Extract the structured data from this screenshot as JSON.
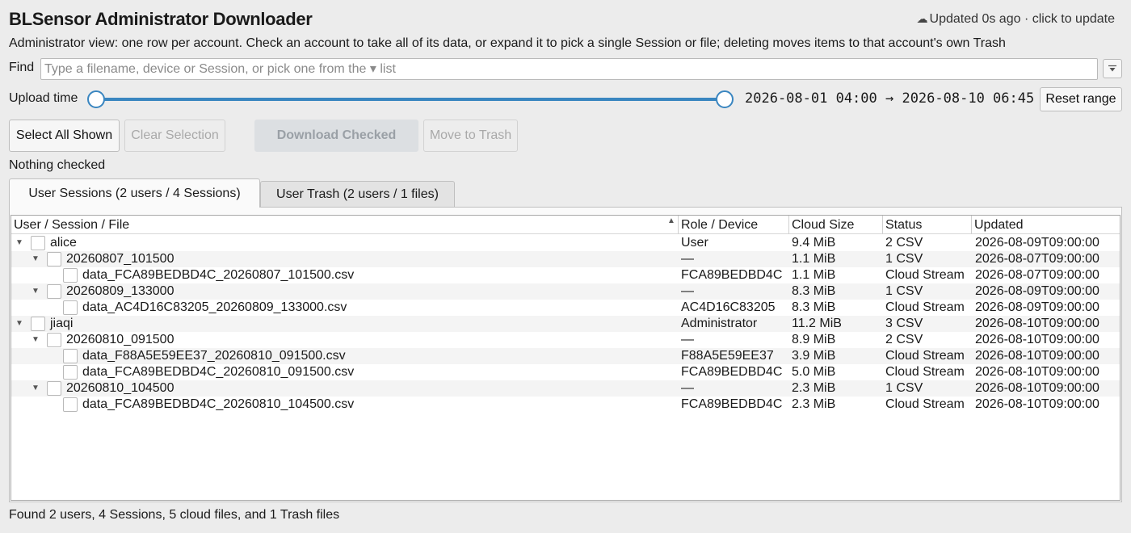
{
  "app": {
    "title": "BLSensor Administrator Downloader",
    "updated_text": "Updated 0s ago · click to update",
    "description": "Administrator view: one row per account. Check an account to take all of its data, or expand it to pick a single Session or file; deleting moves items to that account's own Trash"
  },
  "find": {
    "label": "Find",
    "placeholder": "Type a filename, device or Session, or pick one from the ▾ list",
    "value": ""
  },
  "upload": {
    "label": "Upload time",
    "range_text": "2026-08-01 04:00 → 2026-08-10 06:45",
    "reset_label": "Reset range"
  },
  "toolbar": {
    "select_all": "Select All Shown",
    "clear_selection": "Clear Selection",
    "download_checked": "Download Checked",
    "move_to_trash": "Move to Trash"
  },
  "selection_status": "Nothing checked",
  "tabs": [
    {
      "label": "User Sessions (2 users / 4 Sessions)",
      "active": true
    },
    {
      "label": "User Trash (2 users / 1 files)",
      "active": false
    }
  ],
  "columns": [
    "User / Session / File",
    "Role / Device",
    "Cloud Size",
    "Status",
    "Updated"
  ],
  "rows": [
    {
      "level": 0,
      "expanded": true,
      "name": "alice",
      "role": "User",
      "size": "9.4 MiB",
      "status": "2 CSV",
      "updated": "2026-08-09T09:00:00"
    },
    {
      "level": 1,
      "expanded": true,
      "name": "20260807_101500",
      "role": "—",
      "size": "1.1 MiB",
      "status": "1 CSV",
      "updated": "2026-08-07T09:00:00"
    },
    {
      "level": 2,
      "name": "data_FCA89BEDBD4C_20260807_101500.csv",
      "role": "FCA89BEDBD4C",
      "size": "1.1 MiB",
      "status": "Cloud Stream",
      "updated": "2026-08-07T09:00:00"
    },
    {
      "level": 1,
      "expanded": true,
      "name": "20260809_133000",
      "role": "—",
      "size": "8.3 MiB",
      "status": "1 CSV",
      "updated": "2026-08-09T09:00:00"
    },
    {
      "level": 2,
      "name": "data_AC4D16C83205_20260809_133000.csv",
      "role": "AC4D16C83205",
      "size": "8.3 MiB",
      "status": "Cloud Stream",
      "updated": "2026-08-09T09:00:00"
    },
    {
      "level": 0,
      "expanded": true,
      "name": "jiaqi",
      "role": "Administrator",
      "size": "11.2 MiB",
      "status": "3 CSV",
      "updated": "2026-08-10T09:00:00"
    },
    {
      "level": 1,
      "expanded": true,
      "name": "20260810_091500",
      "role": "—",
      "size": "8.9 MiB",
      "status": "2 CSV",
      "updated": "2026-08-10T09:00:00"
    },
    {
      "level": 2,
      "name": "data_F88A5E59EE37_20260810_091500.csv",
      "role": "F88A5E59EE37",
      "size": "3.9 MiB",
      "status": "Cloud Stream",
      "updated": "2026-08-10T09:00:00"
    },
    {
      "level": 2,
      "name": "data_FCA89BEDBD4C_20260810_091500.csv",
      "role": "FCA89BEDBD4C",
      "size": "5.0 MiB",
      "status": "Cloud Stream",
      "updated": "2026-08-10T09:00:00"
    },
    {
      "level": 1,
      "expanded": true,
      "name": "20260810_104500",
      "role": "—",
      "size": "2.3 MiB",
      "status": "1 CSV",
      "updated": "2026-08-10T09:00:00"
    },
    {
      "level": 2,
      "name": "data_FCA89BEDBD4C_20260810_104500.csv",
      "role": "FCA89BEDBD4C",
      "size": "2.3 MiB",
      "status": "Cloud Stream",
      "updated": "2026-08-10T09:00:00"
    }
  ],
  "footer": "Found 2 users, 4 Sessions, 5 cloud files, and 1 Trash files"
}
